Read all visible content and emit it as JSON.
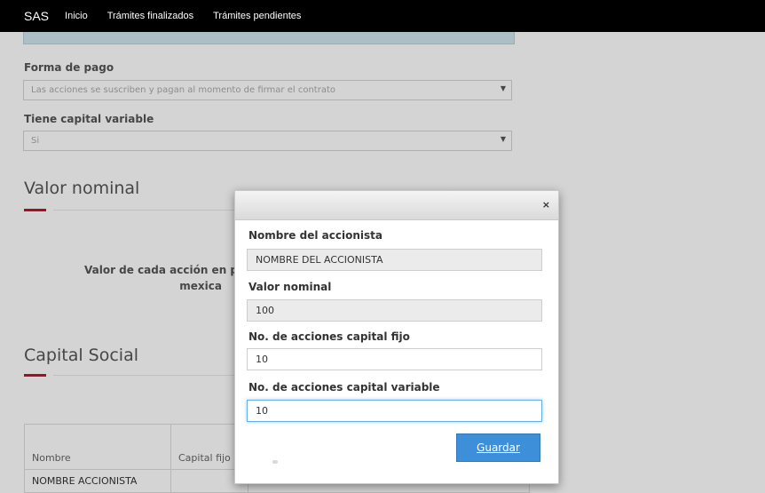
{
  "navbar": {
    "brand": "SAS",
    "links": [
      "Inicio",
      "Trámites finalizados",
      "Trámites pendientes"
    ]
  },
  "form": {
    "forma_pago": {
      "label": "Forma de pago",
      "value": "Las acciones se suscriben y pagan al momento de firmar el contrato"
    },
    "capital_variable": {
      "label": "Tiene capital variable",
      "value": "Si"
    }
  },
  "valor_nominal_section": {
    "title": "Valor nominal",
    "label_line1": "Valor de cada acción en p",
    "label_line2": "mexica"
  },
  "capital_social_section": {
    "title": "Capital Social",
    "table": {
      "headers": [
        "Nombre",
        "Capital fijo"
      ],
      "rows": [
        [
          "NOMBRE ACCIONISTA",
          ""
        ]
      ]
    }
  },
  "modal": {
    "close_glyph": "×",
    "fields": [
      {
        "label": "Nombre del accionista",
        "value": "NOMBRE DEL ACCIONISTA",
        "readonly": true
      },
      {
        "label": "Valor nominal",
        "value": "100",
        "readonly": true
      },
      {
        "label": "No. de acciones capital fijo",
        "value": "10",
        "readonly": false
      },
      {
        "label": "No. de acciones capital variable",
        "value": "10",
        "readonly": false
      }
    ],
    "save_label": "Guardar"
  },
  "icons": {
    "dropdown_arrow": "chevron-down-icon",
    "close": "close-icon"
  },
  "colors": {
    "accent_red": "#c8102e",
    "primary_button": "#3e8fd9",
    "navbar": "#000000"
  }
}
